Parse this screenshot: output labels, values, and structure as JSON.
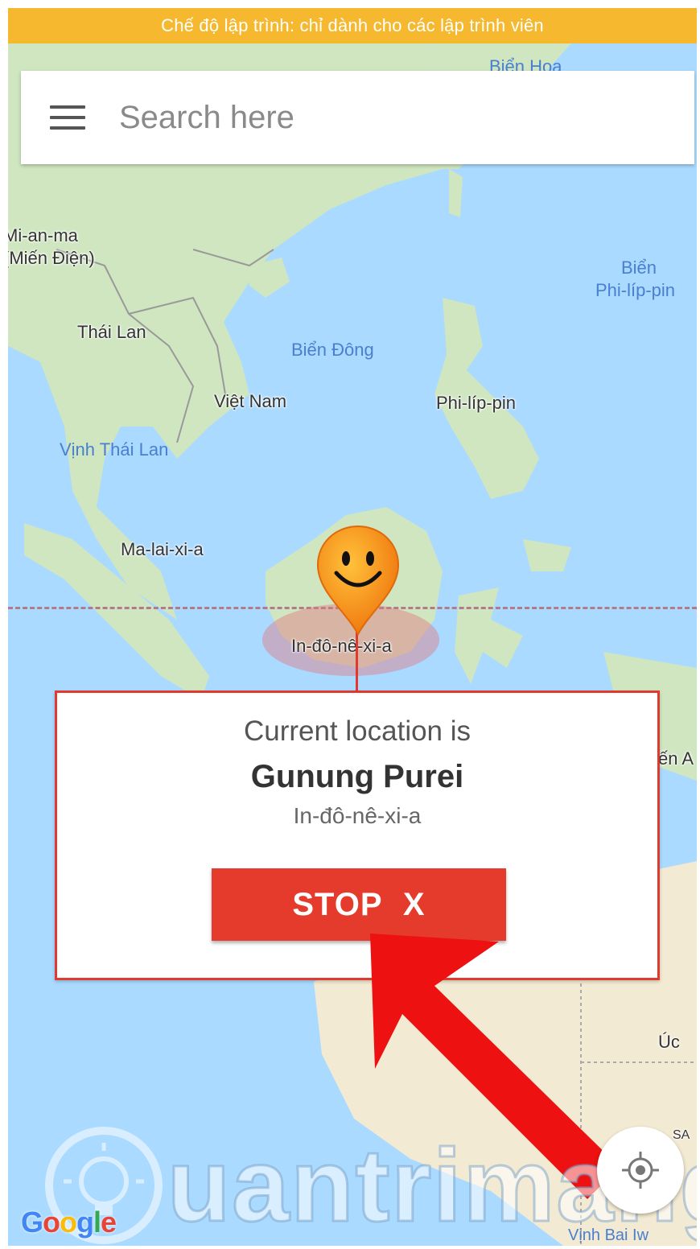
{
  "dev_banner": "Chế độ lập trình: chỉ dành cho các lập trình viên",
  "search": {
    "placeholder": "Search here"
  },
  "map_labels": {
    "bien_hoa": "Biển Hoa",
    "myanmar_1": "Mi-an-ma",
    "myanmar_2": "(Miến Điện)",
    "bien_philippin_1": "Biển",
    "bien_philippin_2": "Phi-líp-pin",
    "thai_lan": "Thái Lan",
    "bien_dong": "Biển Đông",
    "viet_nam": "Việt Nam",
    "philippin": "Phi-líp-pin",
    "vinh_thai_lan": "Vịnh Thái Lan",
    "malaysia": "Ma-lai-xi-a",
    "indonesia": "In-đô-nê-xi-a",
    "uc": "Úc",
    "sa": "SA",
    "en_a": "ến A",
    "vinh_bottom": "Vịnh Bai Iw"
  },
  "info_card": {
    "heading": "Current location is",
    "place": "Gunung Purei",
    "country": "In-đô-nê-xi-a",
    "stop_label": "STOP  X"
  },
  "google_logo": "Google",
  "watermark": "uantrimang",
  "colors": {
    "dev_banner": "#f5b82e",
    "stop_button": "#e43b2c",
    "card_border": "#e03a2e",
    "arrow": "#ee1111",
    "water": "#aadaff",
    "land": "#cfe6c0"
  },
  "icons": {
    "menu": "hamburger-menu-icon",
    "pin": "smiley-pin-icon",
    "gps": "my-location-icon",
    "watermark_logo": "lightbulb-icon"
  }
}
